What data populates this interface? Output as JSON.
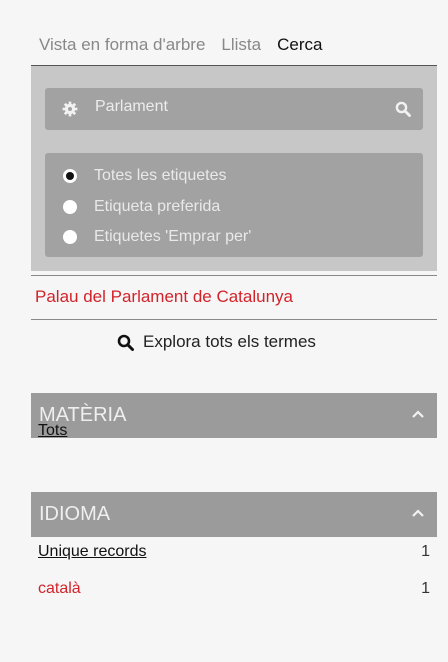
{
  "tabs": [
    {
      "label": "Vista en forma d'arbre",
      "active": false
    },
    {
      "label": "Llista",
      "active": false
    },
    {
      "label": "Cerca",
      "active": true
    }
  ],
  "search": {
    "value": "Parlament",
    "icons": [
      "gear-icon",
      "search-icon"
    ]
  },
  "label_options": [
    {
      "label": "Totes les etiquetes",
      "checked": true
    },
    {
      "label": "Etiqueta preferida",
      "checked": false
    },
    {
      "label": "Etiquetes 'Emprar per'",
      "checked": false
    }
  ],
  "result": {
    "label": "Palau del Parlament de Catalunya"
  },
  "explore": {
    "label": "Explora tots els termes",
    "icon": "search-icon"
  },
  "facets": [
    {
      "title": "MATÈRIA",
      "items": [
        {
          "label": "Tots",
          "count": ""
        }
      ]
    },
    {
      "title": "IDIOMA",
      "items": [
        {
          "label": "Unique records",
          "count": "1"
        },
        {
          "label": "català",
          "count": "1"
        }
      ]
    }
  ],
  "colors": {
    "accent_red": "#d2232a",
    "header_grey": "#9b9b9b",
    "field_grey": "#a2a2a2"
  }
}
